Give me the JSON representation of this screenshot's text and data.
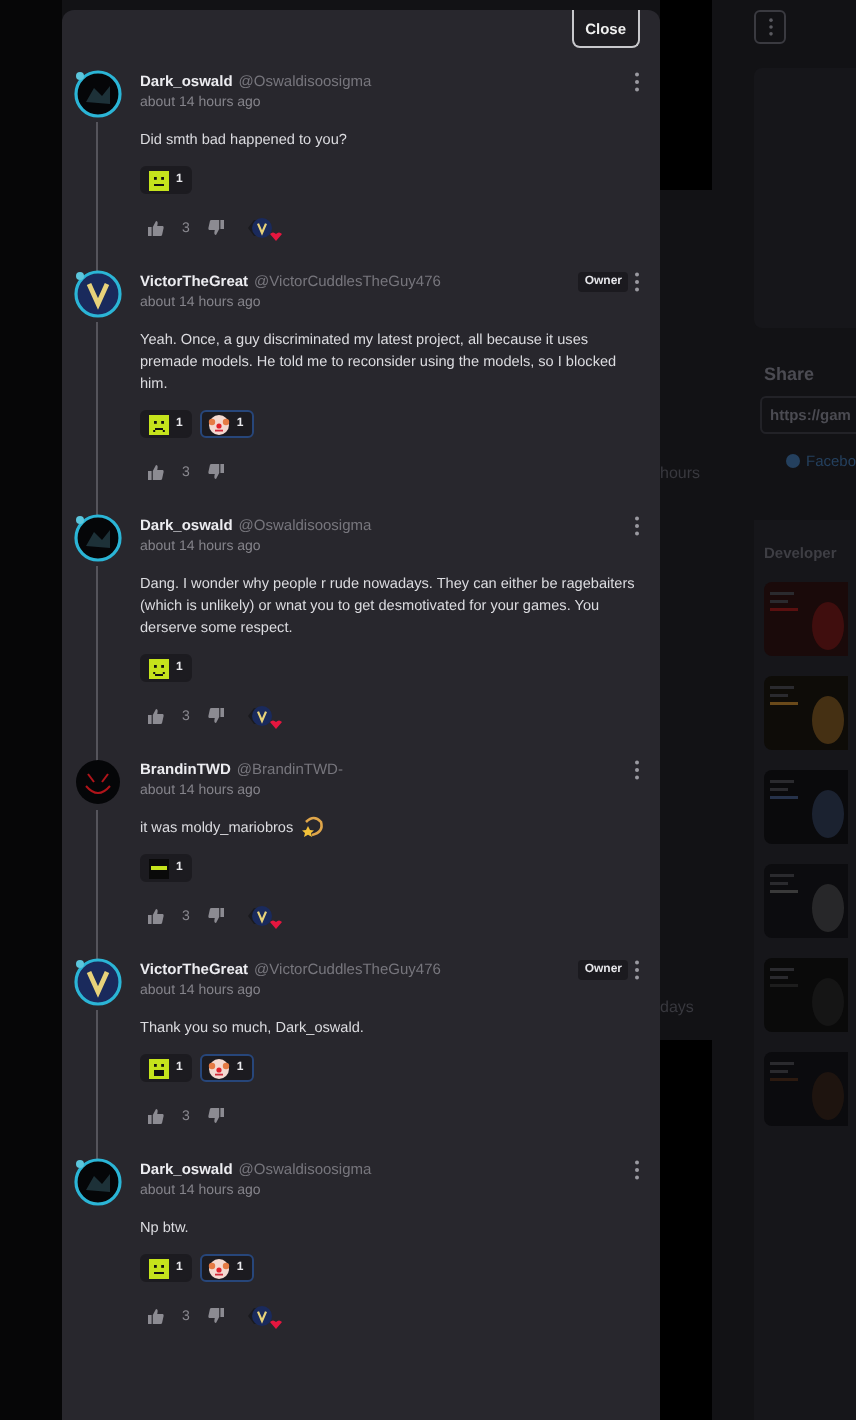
{
  "close_button": "Close",
  "comments": [
    {
      "name": "Dark_oswald",
      "handle": "@Oswaldisoosigma",
      "time": "about 14 hours ago",
      "avatar": {
        "kind": "dark"
      },
      "text": "Did smth bad happened to you?",
      "reactions": [
        {
          "kind": "neutral",
          "count": "1",
          "selected": false
        }
      ],
      "likes": "3",
      "creator_heart": true
    },
    {
      "name": "VictorTheGreat",
      "handle": "@VictorCuddlesTheGuy476",
      "badge": "Owner",
      "time": "about 14 hours ago",
      "avatar": {
        "kind": "v-logo"
      },
      "text": "Yeah. Once, a guy discriminated my latest project, all because it uses premade models. He told me to reconsider using the models, so I blocked him.",
      "reactions": [
        {
          "kind": "sad",
          "count": "1",
          "selected": false
        },
        {
          "kind": "clown",
          "count": "1",
          "selected": true
        }
      ],
      "likes": "3",
      "creator_heart": false
    },
    {
      "name": "Dark_oswald",
      "handle": "@Oswaldisoosigma",
      "time": "about 14 hours ago",
      "avatar": {
        "kind": "dark"
      },
      "text": "Dang. I wonder why people r rude nowadays. They can either be ragebaiters (which is unlikely) or wnat you to get desmotivated for your games. You derserve some respect.",
      "reactions": [
        {
          "kind": "smile",
          "count": "1",
          "selected": false
        }
      ],
      "likes": "3",
      "creator_heart": true
    },
    {
      "name": "BrandinTWD",
      "handle": "@BrandinTWD-",
      "time": "about 14 hours ago",
      "avatar": {
        "kind": "red-mark"
      },
      "text": "it was moldy_mariobros",
      "trailing_icon": {
        "kind": "swirl-star"
      },
      "reactions": [
        {
          "kind": "visor",
          "count": "1",
          "selected": false
        }
      ],
      "likes": "3",
      "creator_heart": true
    },
    {
      "name": "VictorTheGreat",
      "handle": "@VictorCuddlesTheGuy476",
      "badge": "Owner",
      "time": "about 14 hours ago",
      "avatar": {
        "kind": "v-logo"
      },
      "text": "Thank you so much, Dark_oswald.",
      "reactions": [
        {
          "kind": "grin",
          "count": "1",
          "selected": false
        },
        {
          "kind": "clown",
          "count": "1",
          "selected": true
        }
      ],
      "likes": "3",
      "creator_heart": false
    },
    {
      "name": "Dark_oswald",
      "handle": "@Oswaldisoosigma",
      "time": "about 14 hours ago",
      "avatar": {
        "kind": "dark"
      },
      "text": "Np btw.",
      "reactions": [
        {
          "kind": "neutral",
          "count": "1",
          "selected": false
        },
        {
          "kind": "clown",
          "count": "1",
          "selected": true
        }
      ],
      "likes": "3",
      "creator_heart": true
    }
  ],
  "background": {
    "side_texts": [
      "hours",
      "days"
    ],
    "share_title": "Share",
    "share_url": "https://gam",
    "share_link": "Facebo",
    "developer_title": "Developer"
  }
}
